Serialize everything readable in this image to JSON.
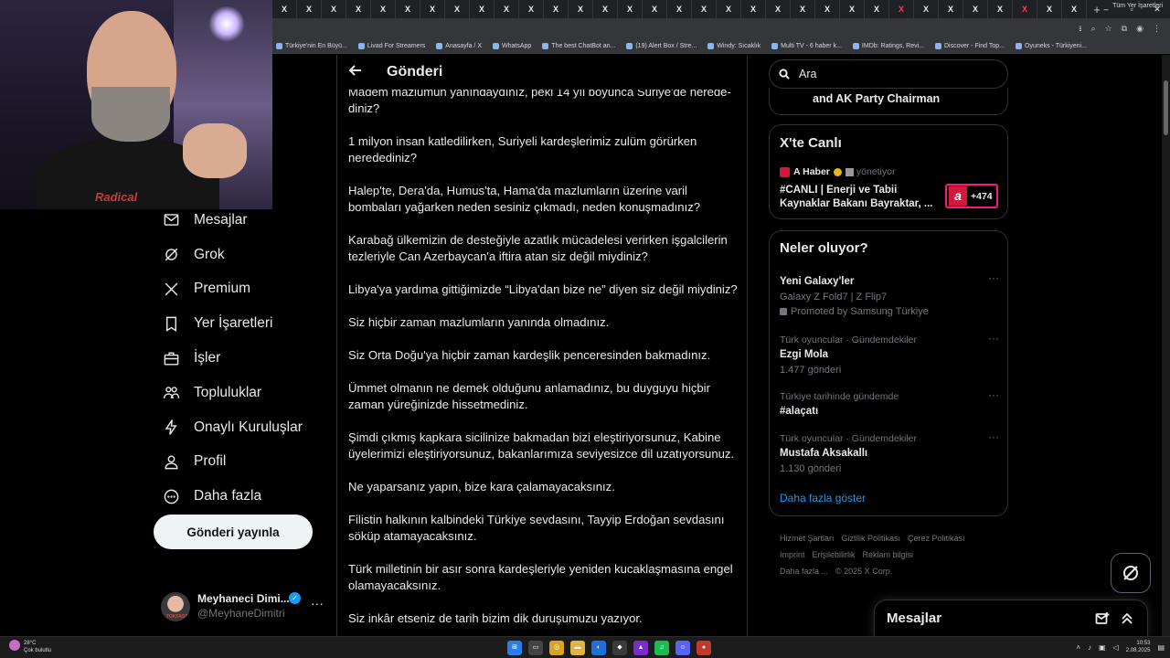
{
  "browser": {
    "tabs": [
      "X",
      "X",
      "X",
      "X",
      "X",
      "X",
      "X",
      "X",
      "X",
      "X",
      "X",
      "X",
      "X",
      "X",
      "X",
      "X",
      "X",
      "X",
      "X",
      "X",
      "X",
      "X",
      "X",
      "X",
      "X",
      "X",
      "X",
      "X",
      "X",
      "X",
      "X",
      "X",
      "X"
    ],
    "new_tab": "+",
    "window_controls": [
      "–",
      "▫",
      "✕"
    ],
    "bookmarks": [
      "Türkiye'nin En Büyü...",
      "Livad For Streamers",
      "Anasayfa / X",
      "WhatsApp",
      "The best ChatBot an...",
      "(19) Alert Box / Stre...",
      "Windy: Sıcaklık",
      "Multi TV - 6 haber k...",
      "IMDb: Ratings, Revi...",
      "Discover - Find Top...",
      "Oyuneks - Türkiyeni..."
    ],
    "all_bookmarks": "Tüm Yer İşaretleri"
  },
  "webcam": {
    "shirt_text": "Radical"
  },
  "nav": {
    "items": [
      {
        "label": "Mesajlar",
        "icon": "mail-icon"
      },
      {
        "label": "Grok",
        "icon": "grok-icon"
      },
      {
        "label": "Premium",
        "icon": "x-logo-icon"
      },
      {
        "label": "Yer İşaretleri",
        "icon": "bookmark-icon"
      },
      {
        "label": "İşler",
        "icon": "briefcase-icon"
      },
      {
        "label": "Topluluklar",
        "icon": "people-icon"
      },
      {
        "label": "Onaylı Kuruluşlar",
        "icon": "lightning-icon"
      },
      {
        "label": "Profil",
        "icon": "person-icon"
      },
      {
        "label": "Daha fazla",
        "icon": "more-circle-icon"
      }
    ],
    "post_button": "Gönderi yayınla",
    "profile": {
      "name": "Meyhaneci Dimi...",
      "handle": "@MeyhaneDimitri",
      "more": "···",
      "avatar_text": "TOKFAST"
    }
  },
  "main": {
    "title": "Gönderi",
    "paragraphs": [
      "Madem mazlumun yanındaydınız, peki 14 yıl boyunca Suriye'de nerede­diniz?",
      "1 milyon insan katledilirken, Suriyeli kardeşlerimiz zulüm görürken nerede­diniz?",
      "Halep'te, Dera'da, Humus'ta, Hama'da mazlumların üzerine varil bombaları yağarken neden sesiniz çıkmadı, neden konuşmadınız?",
      "Karabağ ülkemizin de desteğiyle azatlık mücadelesi verirken işgalcilerin tezleriyle Can Azerbaycan'a iftira atan siz değil miydiniz?",
      "Libya'ya yardıma gittiğimizde “Libya'dan bize ne” diyen siz değil miydiniz?",
      "Siz hiçbir zaman mazlumların yanında olmadınız.",
      "Siz Orta Doğu'ya hiçbir zaman kardeşlik penceresinden bakmadınız.",
      "Ümmet olmanın ne demek olduğunu anlamadınız, bu duyguyu hiçbir zaman yüreğinizde hissetmediniz.",
      "Şimdi çıkmış kapkara sicilinize bakmadan bizi eleştiriyorsunuz, Kabine üyelerimizi eleştiriyorsunuz, bakanlarımıza seviyesizce dil uzatıyorsunuz.",
      "Ne yaparsanız yapın, bize kara çalamayacaksınız.",
      "Filistin halkının kalbindeki Türkiye sevdasını, Tayyip Erdoğan sevdasını söküp atamayacaksınız.",
      "Türk milletinin bir asır sonra kardeşleriyle yeniden kucaklaşmasına engel olamayacaksınız.",
      "Siz inkâr etseniz de tarih bizim dik duruşumuzu yazıyor."
    ]
  },
  "right": {
    "search_placeholder": "Ara",
    "prev_card_text": "and AK Party Chairman",
    "live": {
      "title": "X'te Canlı",
      "host": "A Haber",
      "role": "yönetiyor",
      "headline": "#CANLI | Enerji ve Tabii Kaynaklar Bakanı Bayraktar, ...",
      "count": "+474",
      "logo_letter": "a"
    },
    "trends": {
      "title": "Neler oluyor?",
      "items": [
        {
          "meta": "",
          "name": "Yeni Galaxy'ler",
          "sub": "Galaxy Z Fold7 | Z Flip7",
          "extra": "Promoted by Samsung Türkiye"
        },
        {
          "meta": "Türk oyuncular · Gündemdekiler",
          "name": "Ezgi Mola",
          "sub": "1.477 gönderi",
          "extra": ""
        },
        {
          "meta": "Türkiye tarihinde gündemde",
          "name": "#alaçatı",
          "sub": "",
          "extra": ""
        },
        {
          "meta": "Türk oyuncular · Gündemdekiler",
          "name": "Mustafa Aksakallı",
          "sub": "1.130 gönderi",
          "extra": ""
        }
      ],
      "more_label": "···",
      "show_more": "Daha fazla göster"
    },
    "footer": {
      "links": [
        "Hizmet Şartları",
        "Gizlilik Politikası",
        "Çerez Politikası",
        "Imprint",
        "Erişilebilirlik",
        "Reklam bilgisi",
        "Daha fazla ...",
        "© 2025 X Corp."
      ]
    },
    "messages": "Mesajlar"
  },
  "taskbar": {
    "weather_temp": "28°C",
    "weather_desc": "Çok bulutlu",
    "time": "10:53",
    "date": "2.08.2025"
  },
  "colors": {
    "accent": "#1d9bf0",
    "live_border": "#f91880",
    "ahaber_red": "#d4173a"
  }
}
